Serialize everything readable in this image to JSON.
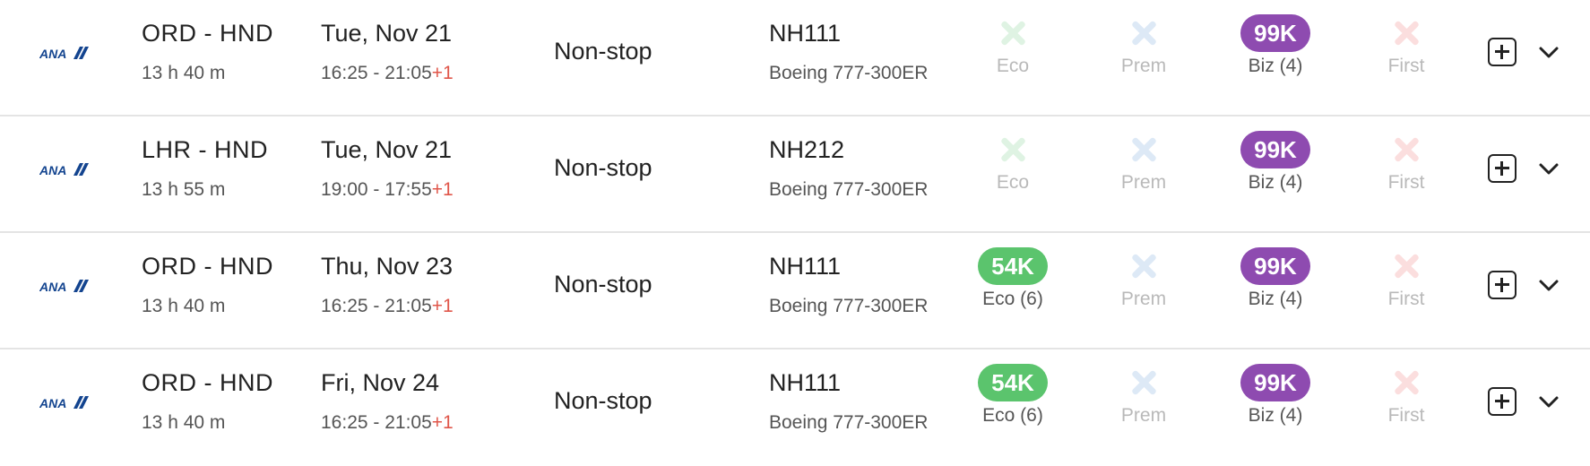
{
  "rows": [
    {
      "airline_icon": "ana-logo-icon",
      "route": "ORD - HND",
      "duration": "13 h 40 m",
      "date": "Tue, Nov 21",
      "times": "16:25 - 21:05",
      "day_offset": "+1",
      "stops": "Non-stop",
      "flight": "NH111",
      "aircraft": "Boeing 777-300ER",
      "eco": {
        "available": false,
        "label": "Eco",
        "price": ""
      },
      "prem": {
        "available": false,
        "label": "Prem",
        "price": ""
      },
      "biz": {
        "available": true,
        "label": "Biz (4)",
        "price": "99K"
      },
      "first": {
        "available": false,
        "label": "First",
        "price": ""
      }
    },
    {
      "airline_icon": "ana-logo-icon",
      "route": "LHR - HND",
      "duration": "13 h 55 m",
      "date": "Tue, Nov 21",
      "times": "19:00 - 17:55",
      "day_offset": "+1",
      "stops": "Non-stop",
      "flight": "NH212",
      "aircraft": "Boeing 777-300ER",
      "eco": {
        "available": false,
        "label": "Eco",
        "price": ""
      },
      "prem": {
        "available": false,
        "label": "Prem",
        "price": ""
      },
      "biz": {
        "available": true,
        "label": "Biz (4)",
        "price": "99K"
      },
      "first": {
        "available": false,
        "label": "First",
        "price": ""
      }
    },
    {
      "airline_icon": "ana-logo-icon",
      "route": "ORD - HND",
      "duration": "13 h 40 m",
      "date": "Thu, Nov 23",
      "times": "16:25 - 21:05",
      "day_offset": "+1",
      "stops": "Non-stop",
      "flight": "NH111",
      "aircraft": "Boeing 777-300ER",
      "eco": {
        "available": true,
        "label": "Eco (6)",
        "price": "54K"
      },
      "prem": {
        "available": false,
        "label": "Prem",
        "price": ""
      },
      "biz": {
        "available": true,
        "label": "Biz (4)",
        "price": "99K"
      },
      "first": {
        "available": false,
        "label": "First",
        "price": ""
      }
    },
    {
      "airline_icon": "ana-logo-icon",
      "route": "ORD - HND",
      "duration": "13 h 40 m",
      "date": "Fri, Nov 24",
      "times": "16:25 - 21:05",
      "day_offset": "+1",
      "stops": "Non-stop",
      "flight": "NH111",
      "aircraft": "Boeing 777-300ER",
      "eco": {
        "available": true,
        "label": "Eco (6)",
        "price": "54K"
      },
      "prem": {
        "available": false,
        "label": "Prem",
        "price": ""
      },
      "biz": {
        "available": true,
        "label": "Biz (4)",
        "price": "99K"
      },
      "first": {
        "available": false,
        "label": "First",
        "price": ""
      }
    }
  ],
  "colors": {
    "eco": "#5bc46d",
    "biz": "#8e4bb0",
    "day_offset": "#e0564a",
    "ana_blue": "#13448f"
  }
}
